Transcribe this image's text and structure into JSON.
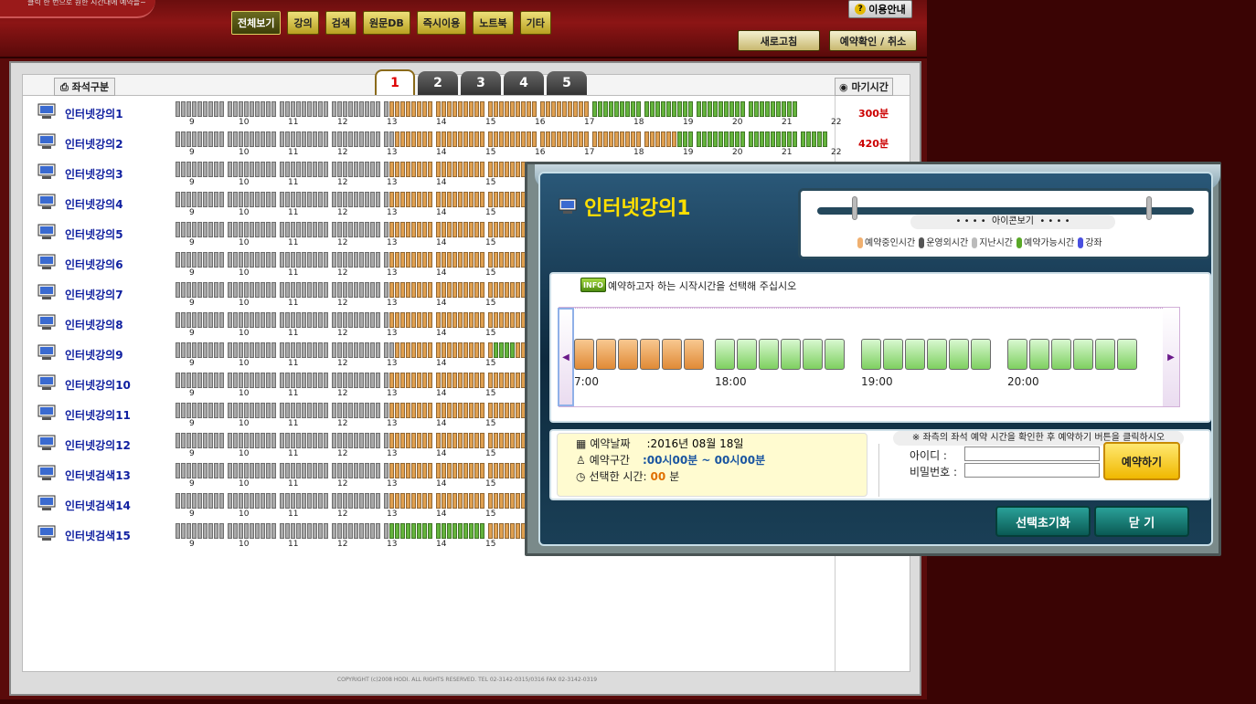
{
  "top": {
    "tagline": "클릭 한 번으로 원한 시간대에 예약을~",
    "nav": [
      "전체보기",
      "강의",
      "검색",
      "원문DB",
      "즉시이용",
      "노트북",
      "기타"
    ],
    "help": "이용안내",
    "refresh": "새로고침",
    "confirm": "예약확인 / 취소"
  },
  "board": {
    "seat_header": "좌석구분",
    "minutes_header": "마기시간",
    "tabs": [
      "1",
      "2",
      "3",
      "4",
      "5"
    ],
    "active_tab": "1",
    "hours": [
      "9",
      "10",
      "11",
      "12",
      "13",
      "14",
      "15",
      "16",
      "17",
      "18",
      "19",
      "20",
      "21",
      "22"
    ],
    "hours_short": [
      "9",
      "10",
      "11",
      "12",
      "13",
      "14",
      "15",
      "16"
    ],
    "rows": [
      {
        "name": "인터넷강의1",
        "minutes": "300분",
        "pattern": "gggggggggggggggggggggggggggggggggggggooooooooooooooooooooooooooooooooooovvvvvvvvvvvvvvvvvvvvvvvvvvvvvvvvvvvv"
      },
      {
        "name": "인터넷강의2",
        "minutes": "420분",
        "pattern": "ggggggggggggggggggggggggggggggggggggggooooooooooooooooooooooooooooooooooooooooooooooooovvvvvvvvvvvvvvvvvvvvvvvvvv"
      },
      {
        "name": "인터넷강의3",
        "minutes": "",
        "pattern": "gggggggggggggggggggggggggggggggggggggoooooooooooooooooooooooooooooooooooooo"
      },
      {
        "name": "인터넷강의4",
        "minutes": "",
        "pattern": "gggggggggggggggggggggggggggggggggggggoooooooooooooooooooooooooooooooooooooo"
      },
      {
        "name": "인터넷강의5",
        "minutes": "",
        "pattern": "gggggggggggggggggggggggggggggggggggggoooooooooooooooooooooooooooooooooooooo"
      },
      {
        "name": "인터넷강의6",
        "minutes": "",
        "pattern": "gggggggggggggggggggggggggggggggggggggoooooooooooooooooooooooooooooooooooooo"
      },
      {
        "name": "인터넷강의7",
        "minutes": "",
        "pattern": "gggggggggggggggggggggggggggggggggggggoooooooooooooooooooooooooooooooooooooo"
      },
      {
        "name": "인터넷강의8",
        "minutes": "",
        "pattern": "gggggggggggggggggggggggggggggggggggggoooooooooooooooooooooooooooooooooooooo"
      },
      {
        "name": "인터넷강의9",
        "minutes": "",
        "pattern": "ggggggggggggggggggggggggggggggggggggggooooooooooooooooovvvvooooooooooooooooooo"
      },
      {
        "name": "인터넷강의10",
        "minutes": "",
        "pattern": "gggggggggggggggggggggggggggggggggggggoooooooooooooooooooooooooooooooooooooo"
      },
      {
        "name": "인터넷강의11",
        "minutes": "",
        "pattern": "gggggggggggggggggggggggggggggggggggggoooooooooooooooooooooooooooooooooooooo"
      },
      {
        "name": "인터넷강의12",
        "minutes": "",
        "pattern": "gggggggggggggggggggggggggggggggggggggoooooooooooooooooooooooooooooooooooooo"
      },
      {
        "name": "인터넷검색13",
        "minutes": "",
        "pattern": "gggggggggggggggggggggggggggggggggggggoooooooooooooooooooooooooooooooooooooo"
      },
      {
        "name": "인터넷검색14",
        "minutes": "",
        "pattern": "gggggggggggggggggggggggggggggggggggggoooooooooooooooooooooooooooooooooooooo"
      },
      {
        "name": "인터넷검색15",
        "minutes": "",
        "pattern": "gggggggggggggggggggggggggggggggggggggvvvvvvvvvvvvvvvvvoooooooooooooooooooooo"
      }
    ],
    "footer": "COPYRIGHT (c)2008 HODI. ALL RIGHTS RESERVED. TEL 02-3142-0315/0316 FAX 02-3142-0319"
  },
  "modal": {
    "title": "인터넷강의1",
    "legend_head": "아이콘보기",
    "legend": [
      {
        "label": "예약중인시간",
        "color": "#f0b070"
      },
      {
        "label": "운영외시간",
        "color": "#555555"
      },
      {
        "label": "지난시간",
        "color": "#bbbbbb"
      },
      {
        "label": "예약가능시간",
        "color": "#5aa828"
      },
      {
        "label": "강좌",
        "color": "#4a50e0"
      }
    ],
    "info_badge": "INFO",
    "info_text": "예약하고자 하는 시작시간을 선택해 주십시오",
    "hour_labels": [
      "7:00",
      "18:00",
      "19:00",
      "20:00"
    ],
    "date_label": "예약날짜",
    "date_value": ":2016년 08월 18일",
    "range_label": "예약구간",
    "range_value": ":00시00분 ~ 00시00분",
    "selected_label": "선택한 시간:",
    "selected_value": "00",
    "selected_unit": "분",
    "hint": "※ 좌측의 좌석 예약 시간을 확인한 후 예약하기 버튼을 클릭하시오",
    "id_label": "아이디 :",
    "pw_label": "비밀번호 :",
    "reserve": "예약하기",
    "reset": "선택초기화",
    "close": "닫  기"
  }
}
